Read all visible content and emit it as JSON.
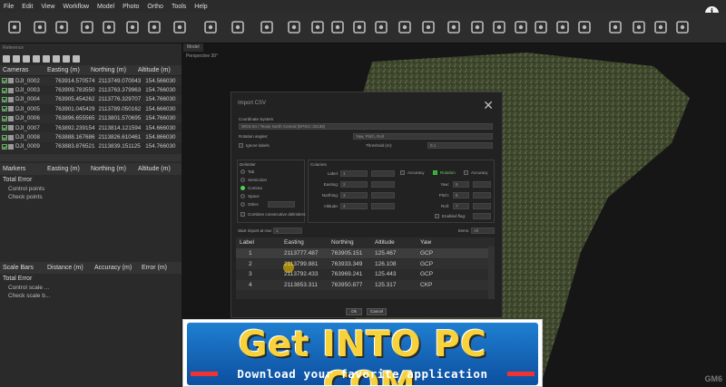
{
  "menu": [
    "File",
    "Edit",
    "View",
    "Workflow",
    "Model",
    "Photo",
    "Ortho",
    "Tools",
    "Help"
  ],
  "toolbar_icons": [
    "new-icon",
    "open-icon",
    "save-icon",
    "undo-icon",
    "redo-icon",
    "pointer-icon",
    "rect-select-icon",
    "resize-icon",
    "navigate-icon",
    "polyline-icon",
    "ruler-icon",
    "close-icon",
    "crop-icon",
    "zoom-in-icon",
    "zoom-out-icon",
    "move-icon",
    "points-icon",
    "grid-points-icon",
    "shape-a-icon",
    "shape-b-icon",
    "shape-c-icon",
    "shape-d-icon",
    "shape-e-icon",
    "shape-f-icon",
    "camera-icon",
    "texture-icon",
    "edit-icon",
    "image-icon",
    "layers-icon"
  ],
  "panel": {
    "title": "Reference",
    "columns": [
      "Cameras",
      "Easting (m)",
      "Northing (m)",
      "Altitude (m)"
    ],
    "rows": [
      [
        "DJI_0002",
        "763914.570574",
        "2113749.070043",
        "154.566030"
      ],
      [
        "DJI_0003",
        "763909.783550",
        "2113763.379963",
        "154.766030"
      ],
      [
        "DJI_0004",
        "763905.454262",
        "2113776.329707",
        "154.766030"
      ],
      [
        "DJI_0005",
        "763901.045429",
        "2113789.050162",
        "154.666030"
      ],
      [
        "DJI_0006",
        "763896.655565",
        "2113801.570695",
        "154.766030"
      ],
      [
        "DJI_0007",
        "763892.239154",
        "2113814.121594",
        "154.666030"
      ],
      [
        "DJI_0008",
        "763888.167686",
        "2113826.610461",
        "154.866030"
      ],
      [
        "DJI_0009",
        "763883.876521",
        "2113839.151125",
        "154.766030"
      ]
    ],
    "markers_columns": [
      "Markers",
      "Easting (m)",
      "Northing (m)",
      "Altitude (m)"
    ],
    "total_error": "Total Error",
    "control_points": "Control points",
    "check_points": "Check points",
    "scale_columns": [
      "Scale Bars",
      "Distance (m)",
      "Accuracy (m)",
      "Error (m)"
    ],
    "total_error2": "Total Error",
    "control_scale": "Control scale ...",
    "check_scale": "Check scale b..."
  },
  "viewport": {
    "tab": "Model",
    "label": "Perspective 30°",
    "watermark": "GM6"
  },
  "dialog": {
    "title": "Import CSV",
    "coordinate_system_label": "Coordinate System",
    "coordinate_system_value": "WGS 84 / Texas North Central (EPSG::32138)",
    "rotation_label": "Rotation angles:",
    "rotation_value": "Yaw, Pitch, Roll",
    "ignore_labels": "Ignore labels",
    "threshold_label": "Threshold (m):",
    "threshold_value": "0.1",
    "delimiter_label": "Delimiter",
    "delimiters": [
      "Tab",
      "Semicolon",
      "Comma",
      "Space",
      "Other:"
    ],
    "combine": "Combine consecutive delimiters",
    "columns_label": "Columns",
    "col_fields": [
      "Label:",
      "Easting:",
      "Northing:",
      "Altitude:"
    ],
    "col_values": [
      "1",
      "2",
      "3",
      "4"
    ],
    "accuracy": "Accuracy",
    "rotation_check": "Rotation",
    "rot_fields": [
      "Yaw:",
      "Pitch:",
      "Roll:"
    ],
    "rot_values": [
      "5",
      "6",
      "7"
    ],
    "enabled_flag": "Enabled flag:",
    "start_import": "Start import at row:",
    "start_value": "1",
    "items_label": "Items:",
    "items_value": "All",
    "table_headers": [
      "Label",
      "Easting",
      "Northing",
      "Altitude",
      "Yaw"
    ],
    "table_rows": [
      [
        "1",
        "2113777.487",
        "763905.151",
        "125.467",
        "GCP"
      ],
      [
        "2",
        "2113799.881",
        "763933.349",
        "126.108",
        "GCP"
      ],
      [
        "3",
        "2113792.433",
        "763969.241",
        "125.443",
        "GCP"
      ],
      [
        "4",
        "2113853.311",
        "763950.877",
        "125.317",
        "CKP"
      ]
    ],
    "ok": "Ok",
    "cancel": "Cancel"
  },
  "banner": {
    "title": "Get INTO PC .COM",
    "subtitle": "Download your favorite application"
  },
  "colors": {
    "accent_green": "#55cc55",
    "banner_blue": "#1f7fd0",
    "banner_yellow": "#f7d23a"
  }
}
